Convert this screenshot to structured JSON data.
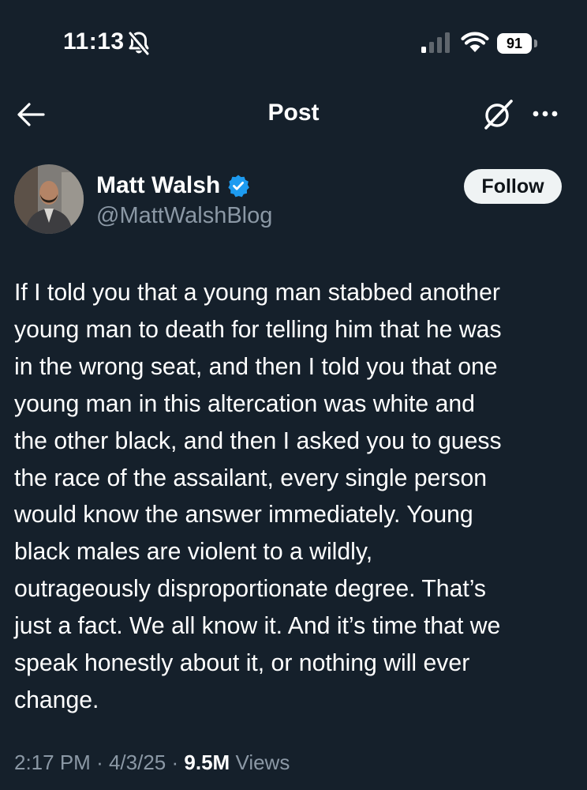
{
  "status_bar": {
    "time": "11:13",
    "battery": "91",
    "icons": [
      "bell-slash-icon",
      "signal-icon",
      "wifi-icon",
      "battery-icon"
    ]
  },
  "nav": {
    "title": "Post",
    "icons": [
      "arrow-left-icon",
      "grok-icon",
      "more-dots-icon"
    ]
  },
  "author": {
    "name": "Matt Walsh",
    "handle": "@MattWalshBlog",
    "verified_color": "#1d9bf0",
    "follow_label": "Follow"
  },
  "post": {
    "text": "If I told you that a young man stabbed another\nyoung man to death for telling him that he was\nin the wrong seat, and then I told you that one\nyoung man in this altercation was white and\nthe other black, and then I asked you to guess\nthe race of the assailant, every single person\nwould know the answer immediately. Young\nblack males are violent to a wildly,\noutrageously disproportionate degree. That’s\njust a fact. We all know it. And it’s time that we\nspeak honestly about it, or nothing will ever\nchange."
  },
  "meta": {
    "time": "2:17 PM",
    "date": "4/3/25",
    "separator": "·",
    "views_count": "9.5M",
    "views_label": "Views"
  },
  "colors": {
    "background": "#15202b",
    "secondary_text": "#8b98a5",
    "follow_bg": "#eff3f4"
  }
}
